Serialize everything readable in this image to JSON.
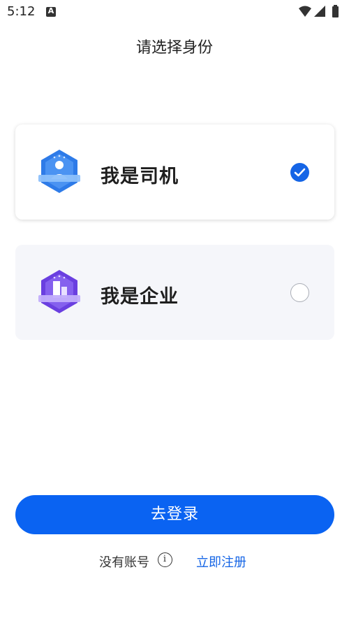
{
  "status_bar": {
    "time": "5:12",
    "notification_icon": "a-notification-icon",
    "wifi_icon": "wifi-icon",
    "signal_icon": "signal-icon",
    "battery_icon": "battery-icon"
  },
  "page": {
    "title": "请选择身份"
  },
  "identities": [
    {
      "label": "我是司机",
      "badge_icon": "driver-badge-icon",
      "selected": true
    },
    {
      "label": "我是企业",
      "badge_icon": "company-badge-icon",
      "selected": false
    }
  ],
  "actions": {
    "login_label": "去登录",
    "no_account_label": "没有账号",
    "register_label": "立即注册"
  },
  "colors": {
    "primary": "#0a63f2",
    "link": "#1565e6",
    "driver_badge": "#2e7be8",
    "company_badge": "#6a3fe0",
    "card_unselected_bg": "#f5f6fa"
  }
}
